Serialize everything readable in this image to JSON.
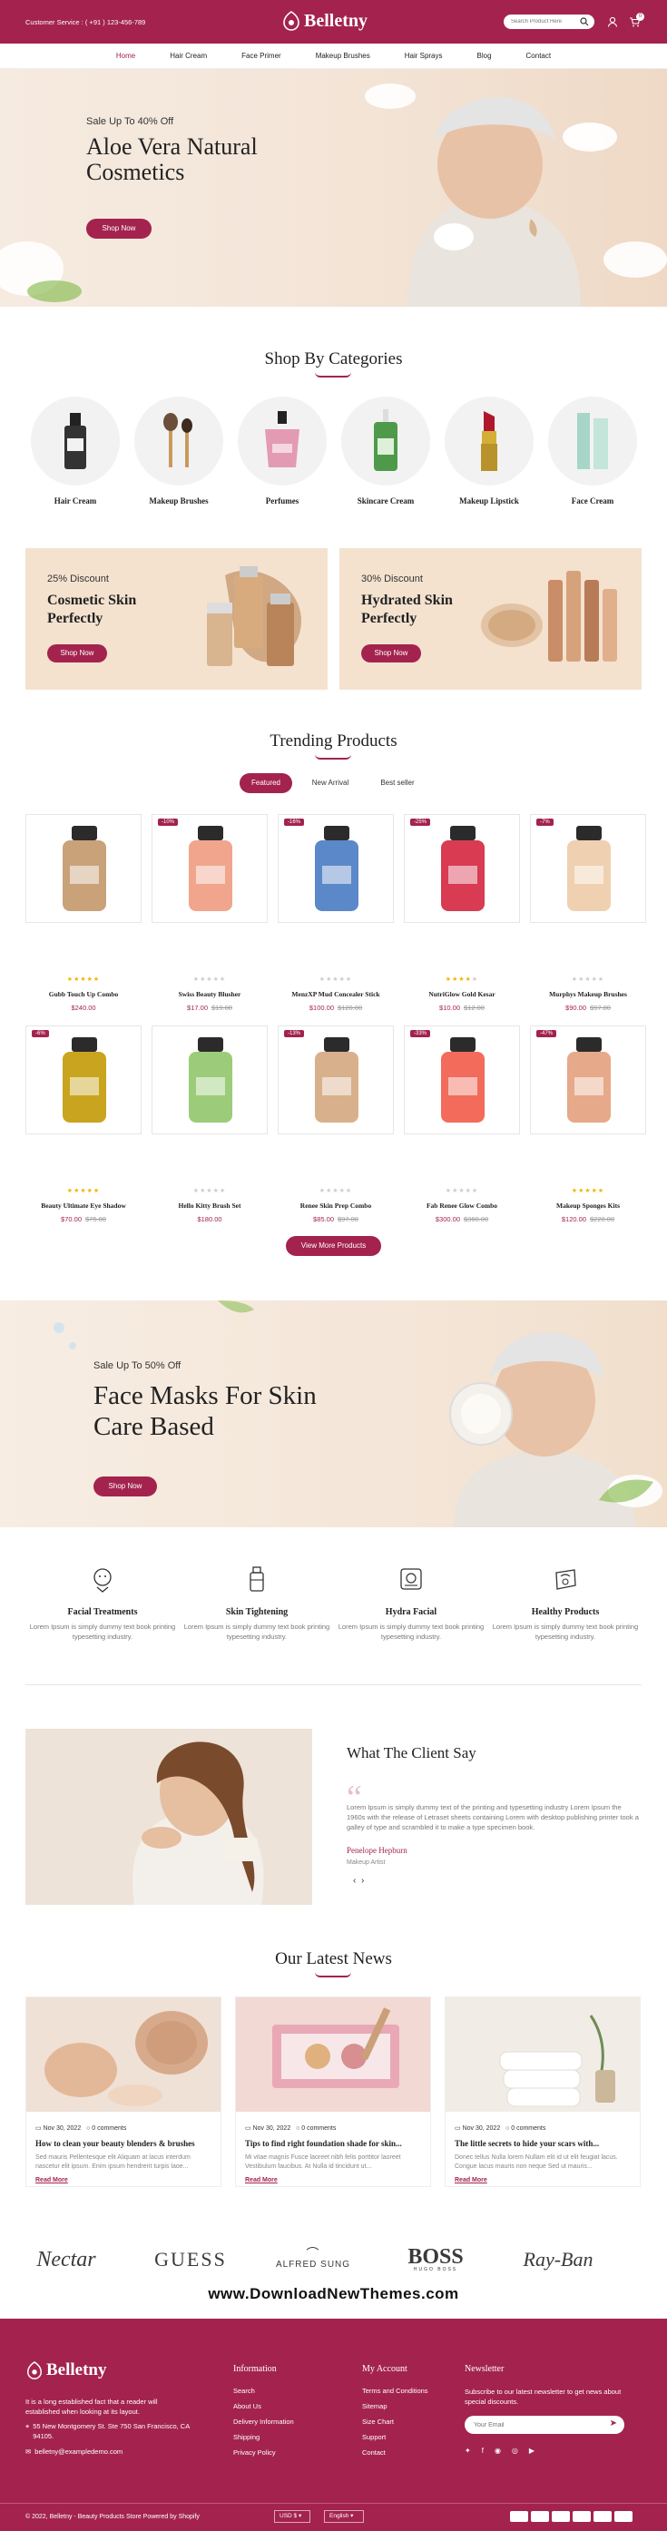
{
  "topbar": {
    "customer_service": "Customer Service : ( +91 ) 123-456-789",
    "logo": "Belletny",
    "search_placeholder": "Search Product Here",
    "cart_count": "0"
  },
  "nav": [
    "Home",
    "Hair Cream",
    "Face Primer",
    "Makeup Brushes",
    "Hair Sprays",
    "Blog",
    "Contact"
  ],
  "hero": {
    "kicker": "Sale Up To 40% Off",
    "title_line1": "Aloe Vera Natural",
    "title_line2": "Cosmetics",
    "button": "Shop Now"
  },
  "categories": {
    "title": "Shop By Categories",
    "items": [
      "Hair Cream",
      "Makeup Brushes",
      "Perfumes",
      "Skincare Cream",
      "Makeup Lipstick",
      "Face Cream"
    ]
  },
  "banners": [
    {
      "discount": "25% Discount",
      "title_line1": "Cosmetic Skin",
      "title_line2": "Perfectly",
      "button": "Shop Now"
    },
    {
      "discount": "30% Discount",
      "title_line1": "Hydrated Skin",
      "title_line2": "Perfectly",
      "button": "Shop Now"
    }
  ],
  "trending": {
    "title": "Trending Products",
    "tabs": [
      "Featured",
      "New Arrival",
      "Best seller"
    ],
    "products": [
      {
        "name": "Gubb Touch Up Combo",
        "price": "$240.00",
        "old": "",
        "badge": "",
        "rating": 5
      },
      {
        "name": "Swiss Beauty Blusher",
        "price": "$17.00",
        "old": "$19.00",
        "badge": "-10%",
        "rating": 0
      },
      {
        "name": "MenzXP Mud Concealer Stick",
        "price": "$100.00",
        "old": "$120.00",
        "badge": "-16%",
        "rating": 0
      },
      {
        "name": "NutriGlow Gold Kesar",
        "price": "$10.00",
        "old": "$12.00",
        "badge": "-25%",
        "rating": 4
      },
      {
        "name": "Murphys Makeup Brushes",
        "price": "$90.00",
        "old": "$97.00",
        "badge": "-7%",
        "rating": 0
      },
      {
        "name": "Beauty Ultimate Eye Shadow",
        "price": "$70.00",
        "old": "$75.00",
        "badge": "-6%",
        "rating": 5
      },
      {
        "name": "Hello Kitty Brush Set",
        "price": "$180.00",
        "old": "",
        "badge": "",
        "rating": 0
      },
      {
        "name": "Renee Skin Prep Combo",
        "price": "$85.00",
        "old": "$97.00",
        "badge": "-13%",
        "rating": 0
      },
      {
        "name": "Fab Renee Glow Combo",
        "price": "$300.00",
        "old": "$360.00",
        "badge": "-33%",
        "rating": 0
      },
      {
        "name": "Makeup Sponges Kits",
        "price": "$120.00",
        "old": "$220.00",
        "badge": "-47%",
        "rating": 5
      }
    ],
    "view_more": "View More Products"
  },
  "hero2": {
    "kicker": "Sale Up To 50% Off",
    "title_line1": "Face Masks For Skin",
    "title_line2": "Care Based",
    "button": "Shop Now"
  },
  "features": [
    {
      "icon": "facial-treatment-icon",
      "title": "Facial Treatments",
      "desc": "Lorem Ipsum is simply dummy text book printing typesetting industry."
    },
    {
      "icon": "skin-tightening-icon",
      "title": "Skin Tightening",
      "desc": "Lorem Ipsum is simply dummy text book printing typesetting industry."
    },
    {
      "icon": "hydra-facial-icon",
      "title": "Hydra Facial",
      "desc": "Lorem Ipsum is simply dummy text book printing typesetting industry."
    },
    {
      "icon": "healthy-products-icon",
      "title": "Healthy Products",
      "desc": "Lorem Ipsum is simply dummy text book printing typesetting industry."
    }
  ],
  "testimonial": {
    "title": "What The Client Say",
    "text": "Lorem Ipsum is simply dummy text of the printing and typesetting industry Lorem Ipsum the 1960s with the release of Letraset sheets containing Lorem with desktop publishing printer took a galley of type and scrambled it to make a type specimen book.",
    "name": "Penelope Hepburn",
    "role": "Makeup Artist"
  },
  "news": {
    "title": "Our Latest News",
    "posts": [
      {
        "date": "Nov 30, 2022",
        "comments": "0 comments",
        "title": "How to clean your beauty blenders & brushes",
        "excerpt": "Sed mauris Pellentesque elit Aliquam at lacus interdum nascetur elit ipsum. Enim ipsum hendrerit turpis laoe...",
        "read": "Read More"
      },
      {
        "date": "Nov 30, 2022",
        "comments": "0 comments",
        "title": "Tips to find right foundation shade for skin...",
        "excerpt": "Mi vitae magnis Fusce laoreet nibh felis porttitor laoreet Vestibulum faucibus. At Nulla id tincidunt ut...",
        "read": "Read More"
      },
      {
        "date": "Nov 30, 2022",
        "comments": "0 comments",
        "title": "The little secrets to hide your scars with...",
        "excerpt": "Donec tellus Nulla lorem Nullam elit id ut elit feugiat lacus. Congue lacus mauris non neque Sed ut mauris...",
        "read": "Read More"
      }
    ]
  },
  "brands": [
    "Nectar",
    "GUESS",
    "ALFRED SUNG",
    "BOSS",
    "Ray-Ban"
  ],
  "brands_sub": {
    "boss": "HUGO BOSS"
  },
  "watermark": "www.DownloadNewThemes.com",
  "footer": {
    "logo": "Belletny",
    "about": "It is a long established fact that a reader will established when looking at its layout.",
    "address": "55 New Montgomery St. Ste 750 San Francisco, CA 94105.",
    "email": "belletny@exampledemo.com",
    "information_title": "Information",
    "information": [
      "Search",
      "About Us",
      "Delivery Information",
      "Shipping",
      "Privacy Policy"
    ],
    "account_title": "My Account",
    "account": [
      "Terms and Conditions",
      "Sitemap",
      "Size Chart",
      "Support",
      "Contact"
    ],
    "newsletter_title": "Newsletter",
    "newsletter_text": "Subscribe to our latest newsletter to get news about special discounts.",
    "email_placeholder": "Your Email",
    "copyright": "© 2022, Belletny - Beauty Products Store Powered by Shopify",
    "currency": "USD $",
    "language": "English"
  },
  "colors": {
    "brand": "#a3234e",
    "cream": "#f4e2cf"
  }
}
